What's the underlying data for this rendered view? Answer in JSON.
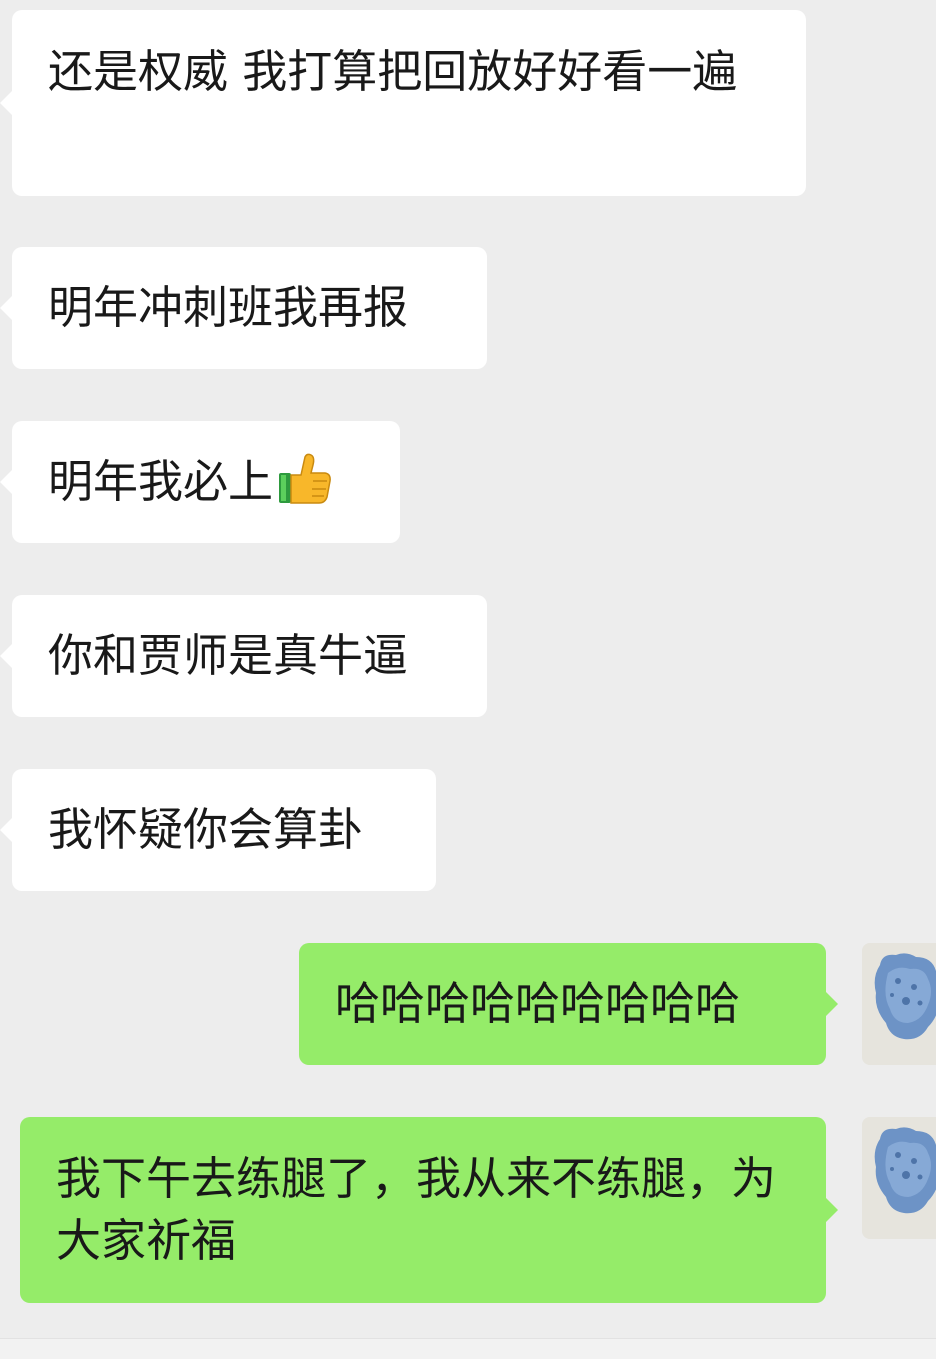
{
  "messages": [
    {
      "side": "in",
      "text": "还是权威 我打算把回放好好看一遍"
    },
    {
      "side": "in",
      "text": "明年冲刺班我再报"
    },
    {
      "side": "in",
      "text": "明年我必上",
      "emoji": "thumbs-up-emoji"
    },
    {
      "side": "in",
      "text": "你和贾师是真牛逼"
    },
    {
      "side": "in",
      "text": "我怀疑你会算卦"
    },
    {
      "side": "out",
      "text": "哈哈哈哈哈哈哈哈哈"
    },
    {
      "side": "out",
      "text": "我下午去练腿了，我从来不练腿，为大家祈福"
    }
  ],
  "colors": {
    "background": "#ededed",
    "incoming_bubble": "#ffffff",
    "outgoing_bubble": "#95ec69",
    "text": "#191919"
  },
  "icons": {
    "emoji": "thumbs-up-emoji",
    "avatar": "user-avatar"
  }
}
